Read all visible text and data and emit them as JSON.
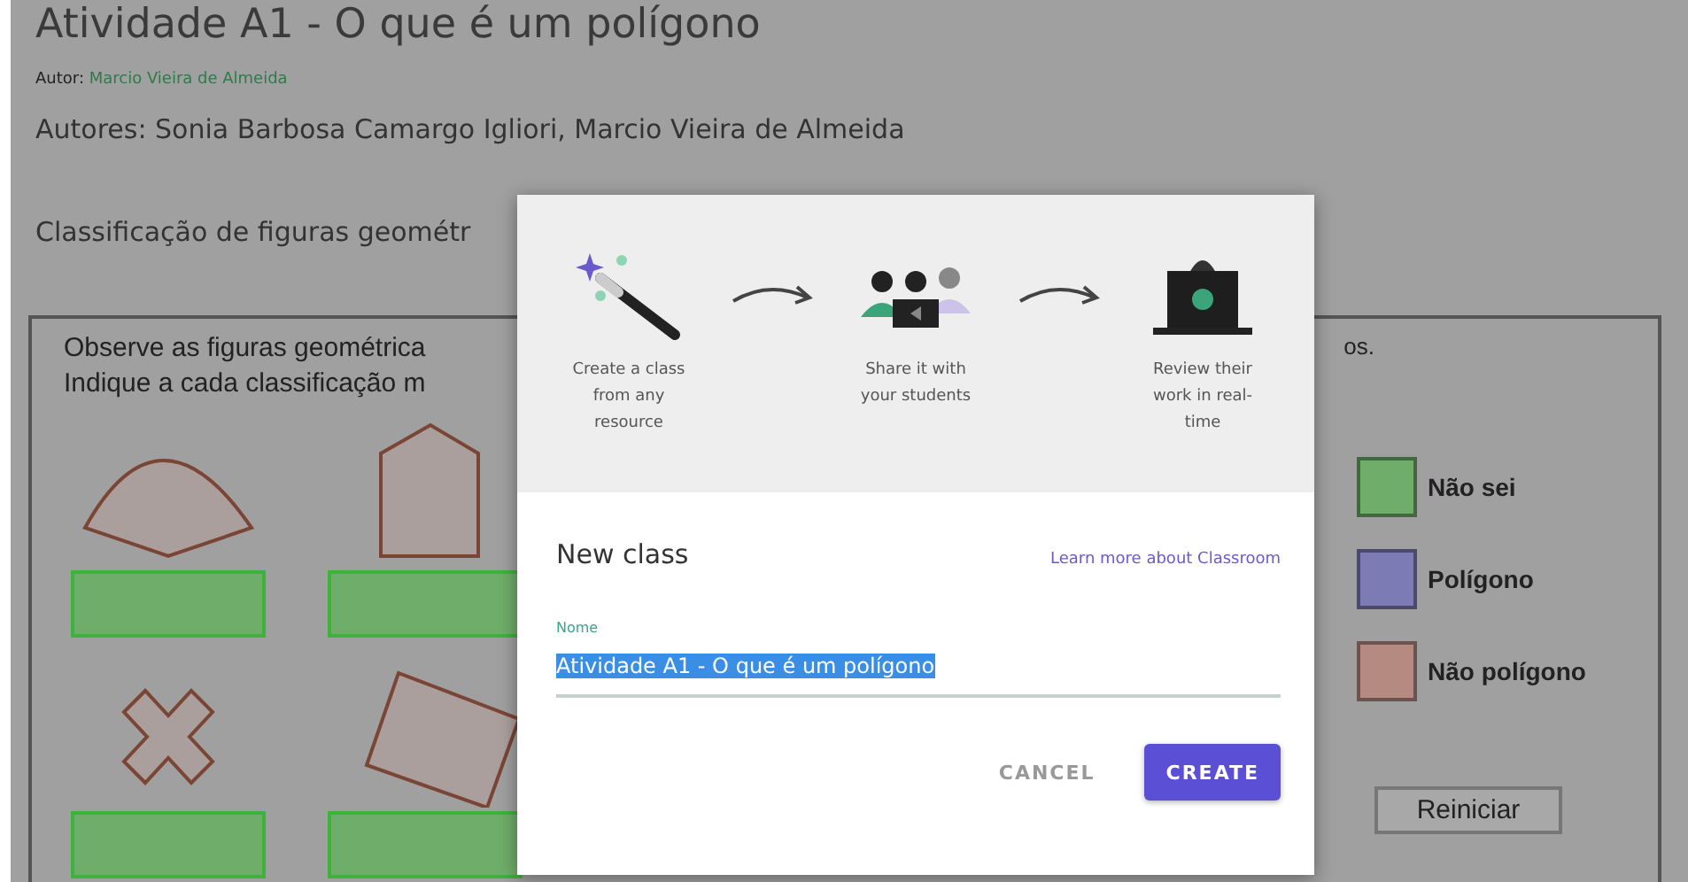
{
  "page": {
    "title": "Atividade A1 - O que é um polígono",
    "author_label": "Autor:",
    "author_link": "Marcio Vieira de Almeida",
    "authors": "Autores: Sonia Barbosa Camargo Igliori, Marcio Vieira de Almeida",
    "section_title": "Classificação de figuras geométr"
  },
  "activity": {
    "instructions": [
      "Observe as figuras geométrica",
      "Indique a cada classificação m"
    ],
    "instruction_tail": "os.",
    "figures": [
      {
        "kind": "sector"
      },
      {
        "kind": "house"
      },
      {
        "kind": "cross"
      },
      {
        "kind": "rectangle"
      }
    ],
    "legend": [
      {
        "label": "Não sei",
        "color": "#6fae6a"
      },
      {
        "label": "Polígono",
        "color": "#7d7bb4"
      },
      {
        "label": "Não polígono",
        "color": "#b58a80"
      }
    ],
    "reset_button": "Reiniciar"
  },
  "dialog": {
    "steps": [
      {
        "kind": "wand",
        "text": "Create a class from any resource"
      },
      {
        "kind": "people",
        "text": "Share it with your students"
      },
      {
        "kind": "laptop",
        "text": "Review their work in real-time"
      }
    ],
    "title": "New class",
    "learn_link": "Learn more about Classroom",
    "field": {
      "label": "Nome",
      "value": "Atividade A1 - O que é um polígono",
      "selected": true
    },
    "buttons": [
      {
        "label": "CANCEL",
        "kind": "text"
      },
      {
        "label": "CREATE",
        "kind": "primary"
      }
    ]
  }
}
